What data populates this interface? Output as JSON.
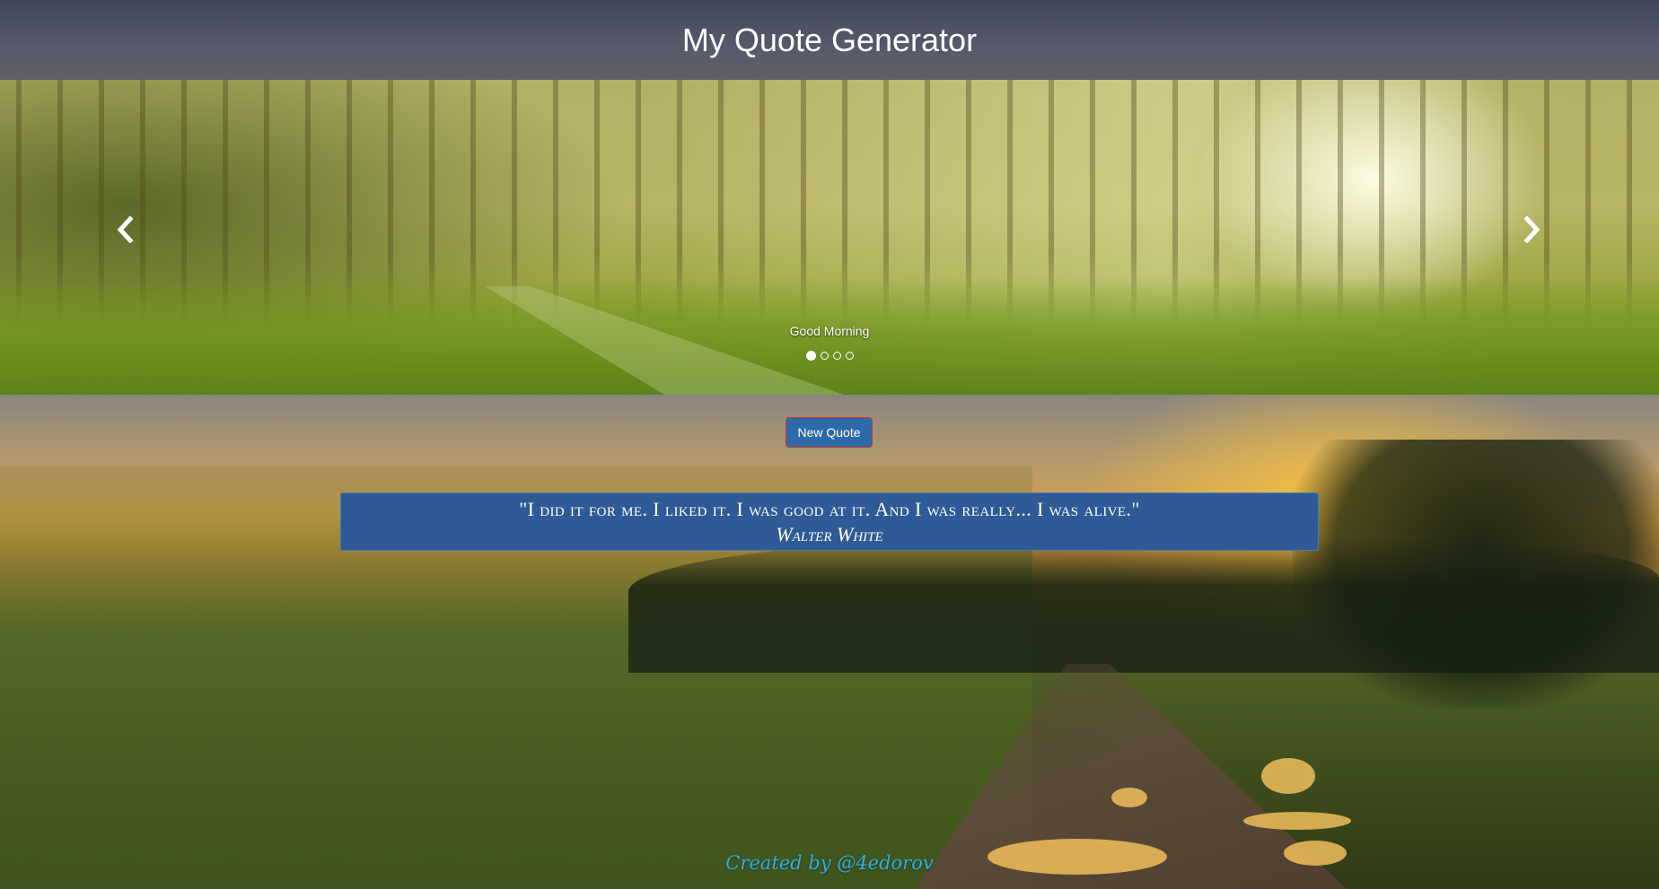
{
  "header": {
    "title": "My Quote Generator"
  },
  "carousel": {
    "caption": "Good Morning",
    "prev_icon": "chevron-left-icon",
    "next_icon": "chevron-right-icon",
    "indicator_count": 4,
    "active_indicator": 1
  },
  "actions": {
    "new_quote_label": "New Quote"
  },
  "quote": {
    "text": "\"I did it for me. I liked it. I was good at it. And I was really... I was alive.\"",
    "author": "Walter White"
  },
  "footer": {
    "credit": "Created by @4edorov"
  },
  "colors": {
    "button_bg": "#2e6aa8",
    "quote_bg": "#2f5a96",
    "footer_text": "#2bb0e8"
  }
}
